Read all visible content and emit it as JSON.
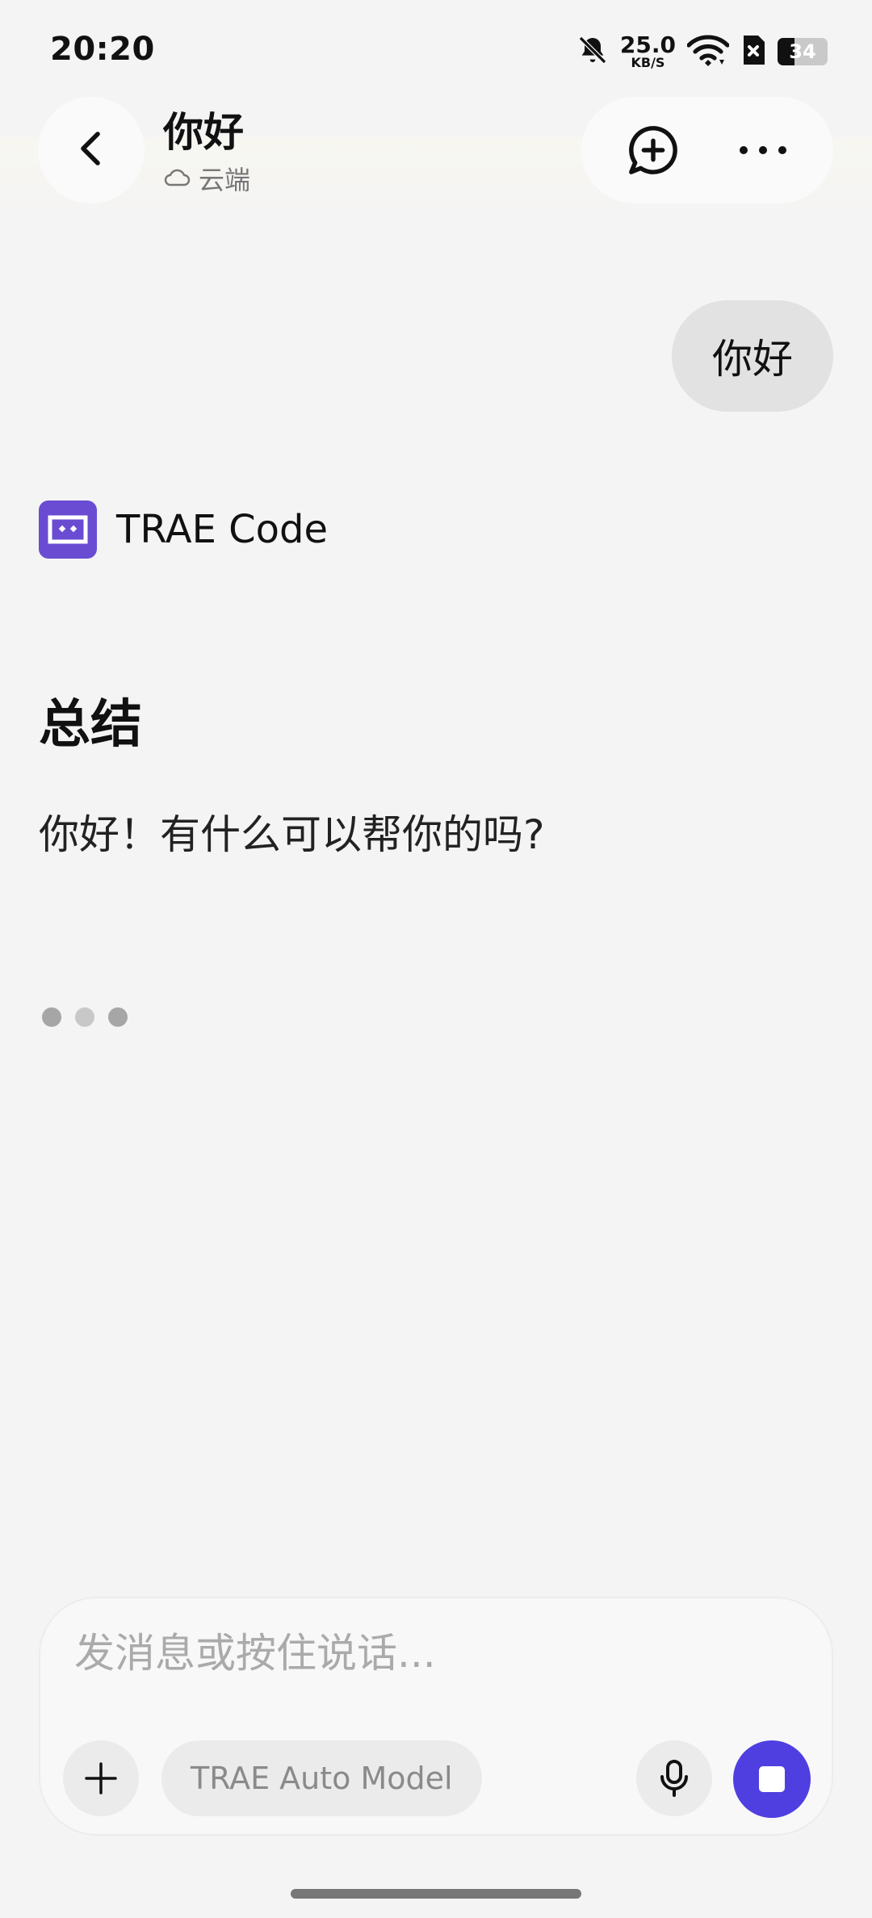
{
  "status_bar": {
    "time": "20:20",
    "net_speed_value": "25.0",
    "net_speed_unit": "KB/S",
    "battery_level": "34",
    "battery_fraction": 0.34,
    "icons": [
      "bell-off-icon",
      "wifi-icon",
      "sim-blocked-icon",
      "battery-icon"
    ]
  },
  "header": {
    "title": "你好",
    "subtitle": "云端",
    "subtitle_icon": "cloud-icon",
    "back_icon": "chevron-left-icon",
    "new_chat_icon": "new-chat-icon",
    "more_icon": "more-horizontal-icon"
  },
  "conversation": {
    "user_message": "你好",
    "agent": {
      "name": "TRAE Code",
      "logo_color": "#6a4cd3"
    },
    "summary_heading": "总结",
    "reply": "你好！有什么可以帮你的吗?",
    "typing_indicator": true
  },
  "composer": {
    "placeholder": "发消息或按住说话...",
    "value": "",
    "model": "TRAE Auto Model",
    "attach_icon": "plus-icon",
    "mic_icon": "microphone-icon",
    "stop_icon": "stop-icon",
    "accent_color": "#4f3fe0"
  }
}
